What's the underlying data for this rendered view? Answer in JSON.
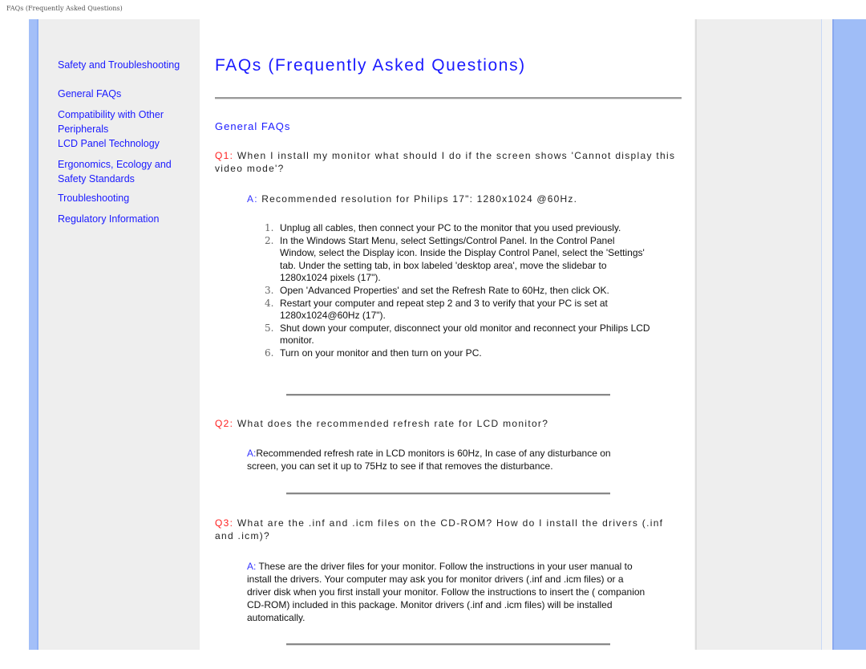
{
  "page_caption": "FAQs (Frequently Asked Questions)",
  "colors": {
    "link": "#1a1aff",
    "question_label": "#ff2020",
    "answer_label": "#3333ff",
    "stripe": "#a3bff8",
    "panel": "#eeeeee"
  },
  "sidebar": {
    "items": [
      {
        "label": "Safety and Troubleshooting"
      },
      {
        "label": "General FAQs"
      },
      {
        "label": "Compatibility with Other Peripherals"
      },
      {
        "label": "LCD Panel Technology"
      },
      {
        "label": "Ergonomics, Ecology and Safety Standards"
      },
      {
        "label": "Troubleshooting"
      },
      {
        "label": "Regulatory Information"
      }
    ]
  },
  "main": {
    "title": "FAQs (Frequently Asked Questions)",
    "section": "General FAQs",
    "q1": {
      "label": "Q1:",
      "text": " When I install my monitor what should I do if the screen shows 'Cannot display this video mode'?",
      "answer_label": "A:",
      "answer": " Recommended resolution for Philips 17\": 1280x1024 @60Hz.",
      "steps": [
        {
          "num": "1.",
          "text": "Unplug all cables, then connect your PC to the monitor that you used previously."
        },
        {
          "num": "2.",
          "text": "In the Windows Start Menu, select Settings/Control Panel. In the Control Panel Window, select the Display icon. Inside the Display Control Panel, select the 'Settings' tab. Under the setting tab, in box labeled 'desktop area', move the slidebar to 1280x1024 pixels (17\")."
        },
        {
          "num": "3.",
          "text": "Open 'Advanced Properties' and set the Refresh Rate to 60Hz, then click OK."
        },
        {
          "num": "4.",
          "text": "Restart your computer and repeat step 2 and 3 to verify that your PC is set at 1280x1024@60Hz (17\")."
        },
        {
          "num": "5.",
          "text": "Shut down your computer, disconnect your old monitor and reconnect your Philips LCD monitor."
        },
        {
          "num": "6.",
          "text": "Turn on your monitor and then turn on your PC."
        }
      ]
    },
    "q2": {
      "label": "Q2:",
      "text": " What does the recommended refresh rate for LCD monitor?",
      "answer_label": "A:",
      "answer": "Recommended refresh rate in LCD monitors is 60Hz, In case of any disturbance on screen, you can set it up to 75Hz to see if that removes the disturbance."
    },
    "q3": {
      "label": "Q3:",
      "text": " What are the .inf and .icm files on the CD-ROM? How do I install the drivers (.inf and .icm)?",
      "answer_label": "A:",
      "answer": " These are the driver files for your monitor. Follow the instructions in your user manual to install the drivers. Your computer may ask you for monitor drivers (.inf and .icm files) or a driver disk when you first install your monitor. Follow the instructions to insert the ( companion CD-ROM) included in this package. Monitor drivers (.inf and .icm files) will be installed automatically."
    }
  }
}
